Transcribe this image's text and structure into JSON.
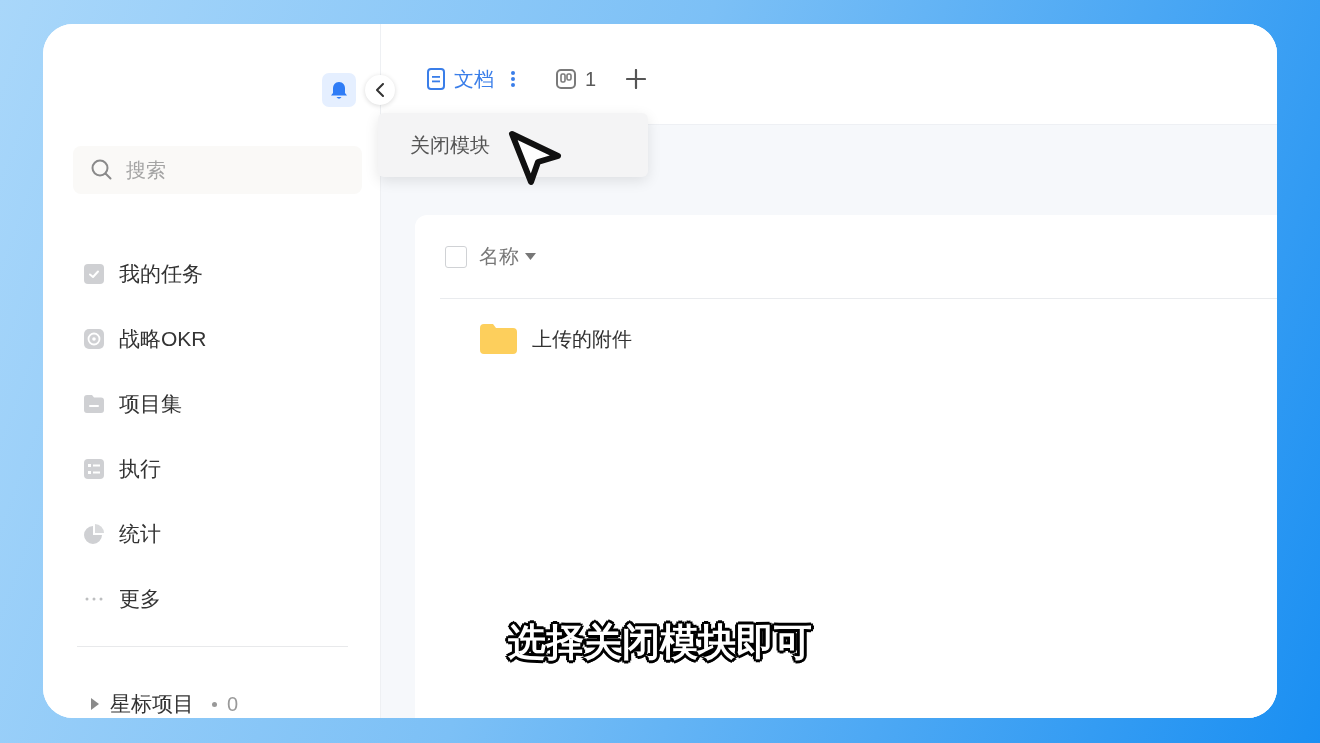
{
  "sidebar": {
    "search": {
      "placeholder": "搜索"
    },
    "items": [
      {
        "label": "我的任务",
        "kind": "tasks",
        "selected": false
      },
      {
        "label": "战略OKR",
        "kind": "okr",
        "selected": false
      },
      {
        "label": "项目集",
        "kind": "folder",
        "selected": false
      },
      {
        "label": "执行",
        "kind": "list",
        "selected": false
      },
      {
        "label": "统计",
        "kind": "chart",
        "selected": false
      },
      {
        "label": "更多",
        "kind": "more",
        "selected": false
      }
    ],
    "starred": {
      "label": "星标项目",
      "count": "0",
      "expanded": false
    }
  },
  "tabs": [
    {
      "label": "文档",
      "kind": "doc",
      "selected": true
    },
    {
      "label": "1",
      "kind": "board",
      "selected": false
    }
  ],
  "context_menu": {
    "items": [
      "关闭模块"
    ]
  },
  "file_list": {
    "select_all": {
      "checked": false
    },
    "columns": [
      {
        "label": "名称"
      }
    ],
    "rows": [
      {
        "name": "上传的附件",
        "kind": "folder"
      }
    ]
  },
  "caption": "选择关闭模块即可"
}
